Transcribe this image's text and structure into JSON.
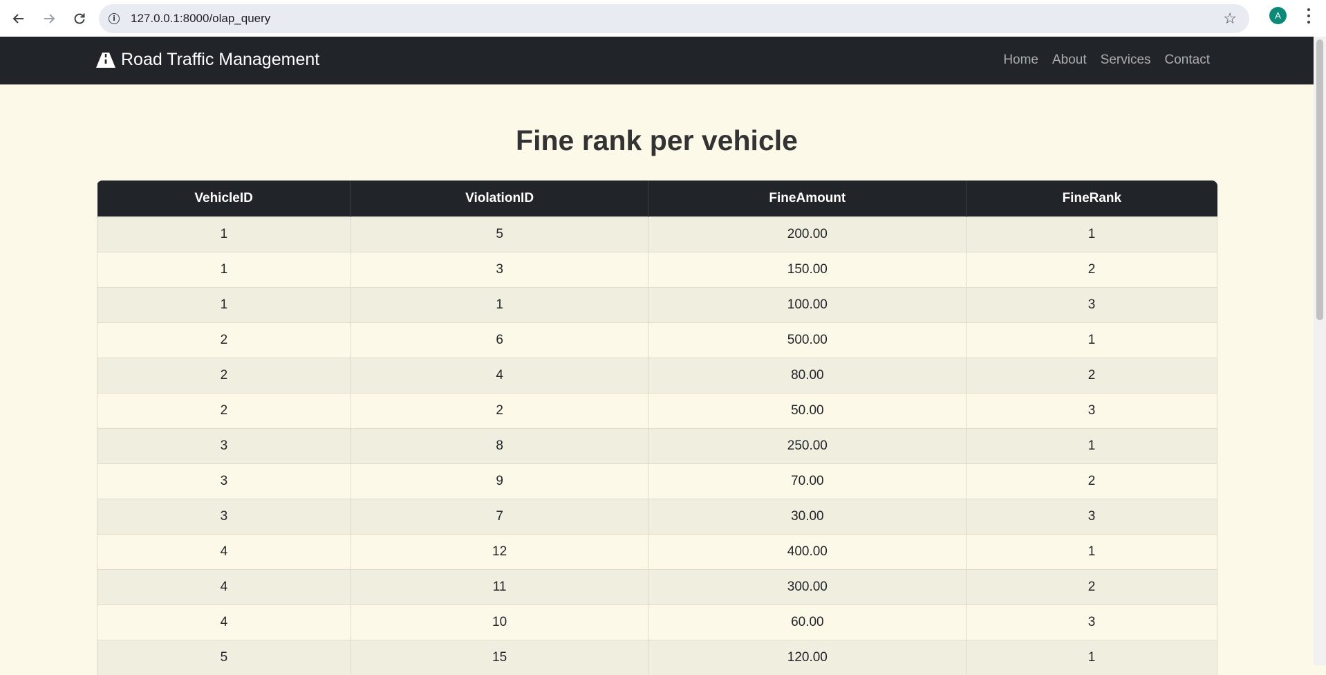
{
  "browser": {
    "url": "127.0.0.1:8000/olap_query",
    "avatar_letter": "A"
  },
  "navbar": {
    "brand": "Road Traffic Management",
    "links": [
      "Home",
      "About",
      "Services",
      "Contact"
    ]
  },
  "page": {
    "title": "Fine rank per vehicle"
  },
  "table": {
    "headers": [
      "VehicleID",
      "ViolationID",
      "FineAmount",
      "FineRank"
    ],
    "rows": [
      [
        "1",
        "5",
        "200.00",
        "1"
      ],
      [
        "1",
        "3",
        "150.00",
        "2"
      ],
      [
        "1",
        "1",
        "100.00",
        "3"
      ],
      [
        "2",
        "6",
        "500.00",
        "1"
      ],
      [
        "2",
        "4",
        "80.00",
        "2"
      ],
      [
        "2",
        "2",
        "50.00",
        "3"
      ],
      [
        "3",
        "8",
        "250.00",
        "1"
      ],
      [
        "3",
        "9",
        "70.00",
        "2"
      ],
      [
        "3",
        "7",
        "30.00",
        "3"
      ],
      [
        "4",
        "12",
        "400.00",
        "1"
      ],
      [
        "4",
        "11",
        "300.00",
        "2"
      ],
      [
        "4",
        "10",
        "60.00",
        "3"
      ],
      [
        "5",
        "15",
        "120.00",
        "1"
      ]
    ]
  },
  "colors": {
    "navbar_bg": "#212529",
    "page_bg": "#fdf9e8",
    "row_stripe": "#f0eedf",
    "avatar_bg": "#0b8a7a"
  }
}
